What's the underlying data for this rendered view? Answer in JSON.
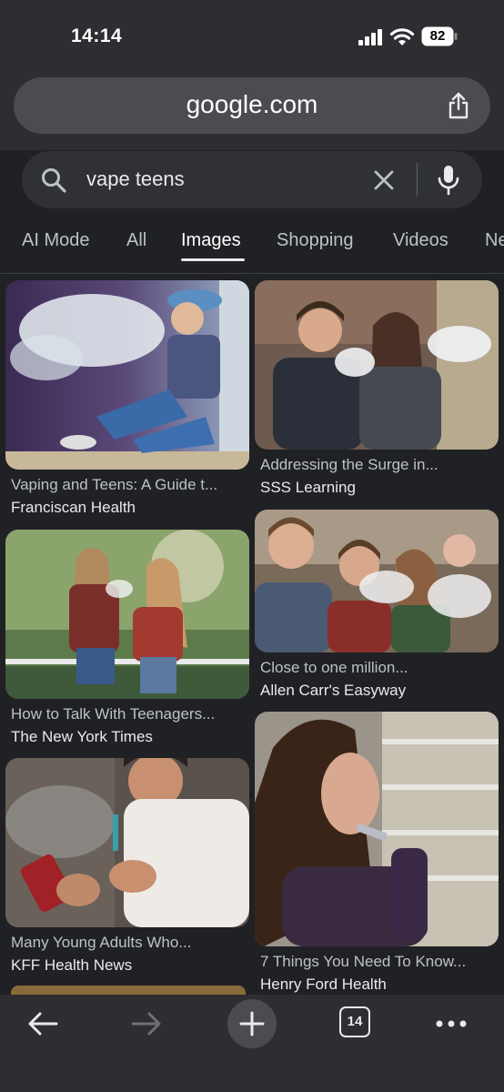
{
  "status_bar": {
    "time": "14:14",
    "battery": "82"
  },
  "browser": {
    "url": "google.com",
    "tab_count": "14"
  },
  "search": {
    "query": "vape teens"
  },
  "tabs": [
    {
      "label": "AI Mode"
    },
    {
      "label": "All"
    },
    {
      "label": "Images",
      "active": true
    },
    {
      "label": "Shopping"
    },
    {
      "label": "Videos"
    },
    {
      "label": "Ne"
    }
  ],
  "results": [
    {
      "title": "Vaping and Teens: A Guide t...",
      "source": "Franciscan Health"
    },
    {
      "title": "Addressing the Surge in...",
      "source": "SSS Learning"
    },
    {
      "title": "How to Talk With Teenagers...",
      "source": "The New York Times"
    },
    {
      "title": "Close to one million...",
      "source": "Allen Carr's Easyway"
    },
    {
      "title": "Many Young Adults Who...",
      "source": "KFF Health News"
    },
    {
      "title": "7 Things You Need To Know...",
      "source": "Henry Ford Health"
    }
  ],
  "colors": {
    "background": "#202124",
    "chrome": "#2d2e31",
    "url_bar": "#4a4c51",
    "search_box": "#303134"
  }
}
